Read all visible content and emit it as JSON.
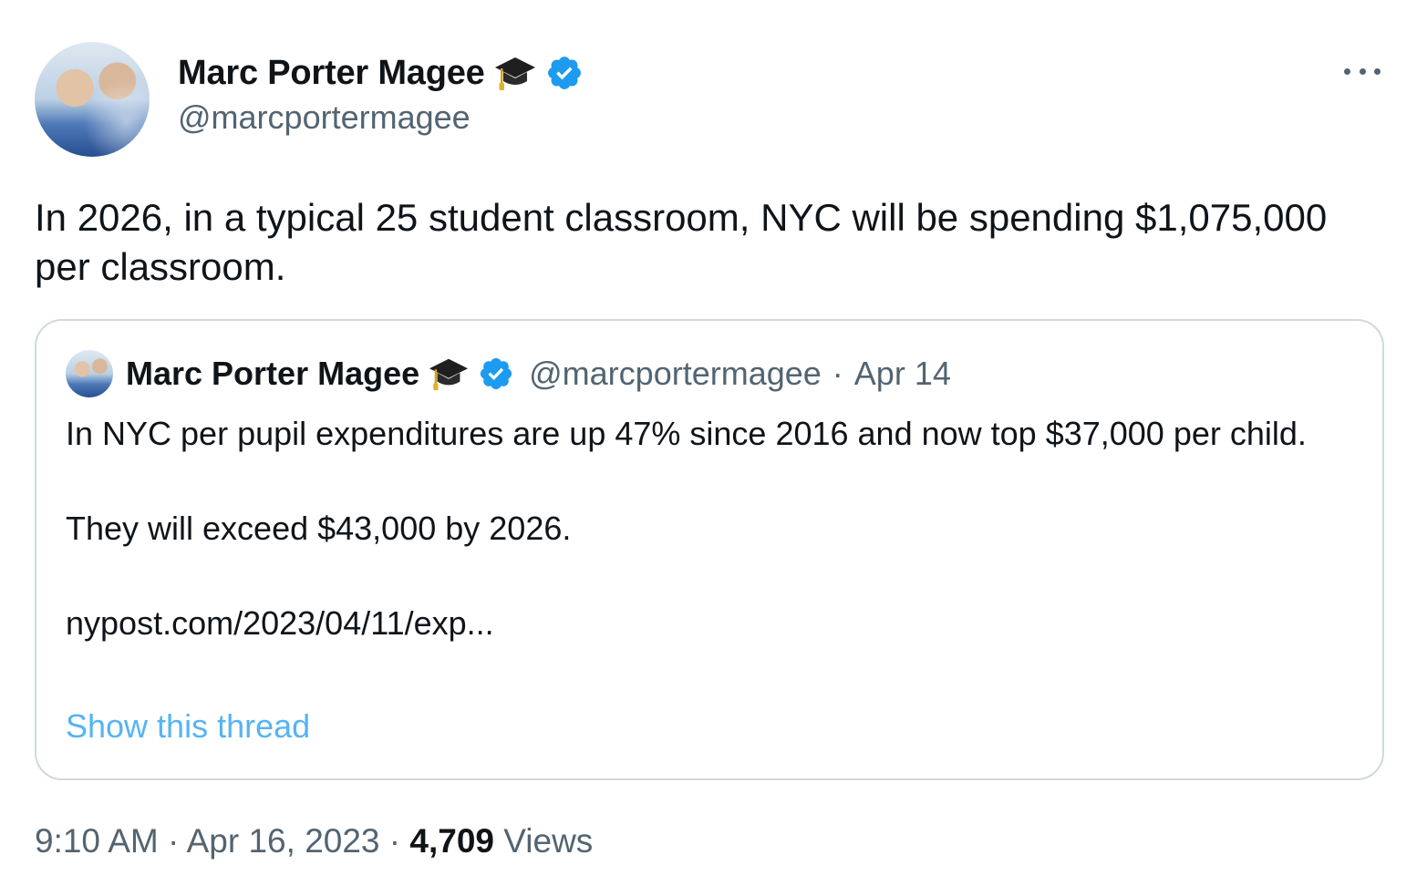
{
  "author": {
    "name": "Marc Porter Magee",
    "handle": "@marcportermagee"
  },
  "tweet": {
    "text": "In 2026, in a typical 25 student classroom, NYC will be spending $1,075,000 per classroom."
  },
  "quoted": {
    "name": "Marc Porter Magee",
    "handle": "@marcportermagee",
    "separator": "·",
    "date": "Apr 14",
    "para1": "In NYC per pupil expenditures are up 47% since 2016 and now top $37,000 per child.",
    "para2": "They will exceed $43,000 by 2026.",
    "link": "nypost.com/2023/04/11/exp...",
    "show_thread": "Show this thread"
  },
  "footer": {
    "time": "9:10 AM",
    "sep1": "·",
    "date": "Apr 16, 2023",
    "sep2": "·",
    "views_count": "4,709",
    "views_label": "Views"
  },
  "colors": {
    "verified": "#1d9bf0",
    "link": "#1d9bf0",
    "muted": "#536471",
    "border": "#cfd9de"
  },
  "icons": {
    "badge": "graduation-cap-icon",
    "verified": "verified-badge-icon",
    "more": "more-options-icon"
  }
}
